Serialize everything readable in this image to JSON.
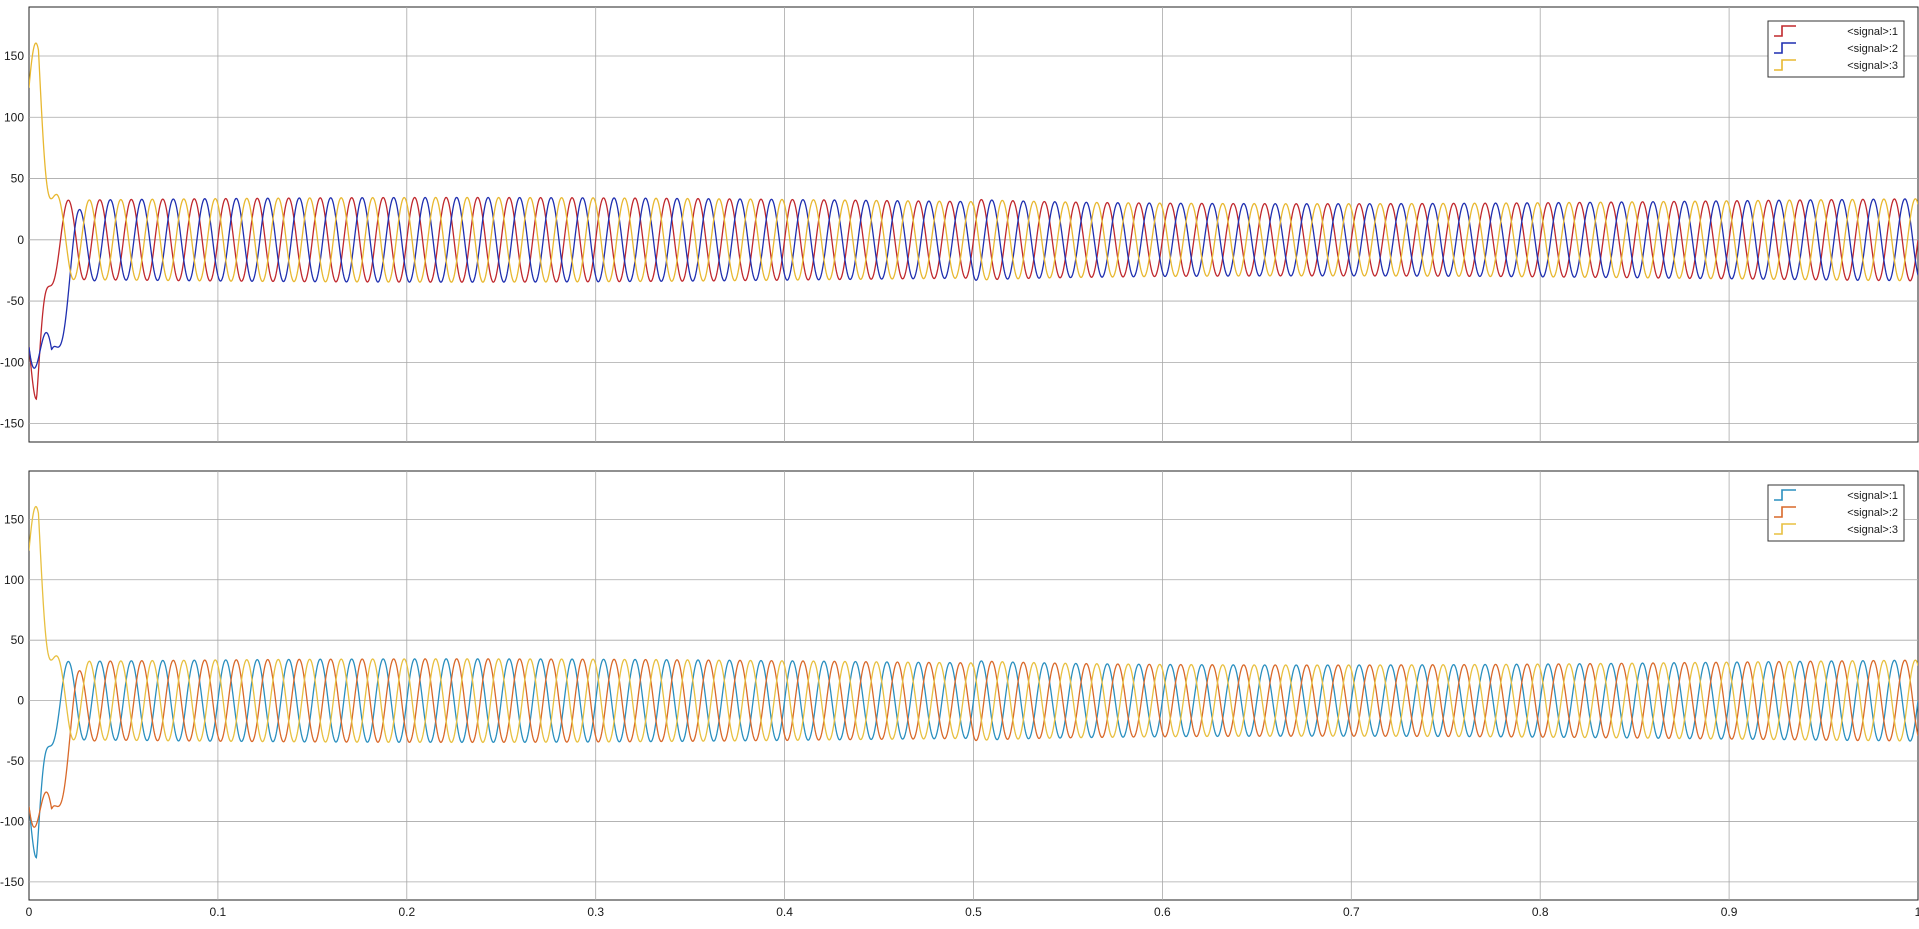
{
  "chart_data": [
    {
      "type": "line",
      "panel": "top",
      "x_range": [
        0,
        1
      ],
      "ylim": [
        -165,
        190
      ],
      "yticks": [
        150,
        100,
        50,
        0,
        -50,
        -100,
        -150
      ],
      "xticks": [
        0.1,
        0.2,
        0.3,
        0.4,
        0.5,
        0.6,
        0.7,
        0.8,
        0.9
      ],
      "x_tick_labels_shown": false,
      "grid": true,
      "legend_position": "top-right",
      "frequency_hz": 60,
      "series": [
        {
          "name": "<signal>:1",
          "color": "#c0282d",
          "steady_amplitude": 32,
          "phase_deg": 0,
          "transient_extreme": {
            "t": 0.004,
            "y": -130
          }
        },
        {
          "name": "<signal>:2",
          "color": "#1f2fb0",
          "steady_amplitude": 32,
          "phase_deg": -120,
          "transient_extreme": {
            "t": 0.012,
            "y": -90
          }
        },
        {
          "name": "<signal>:3",
          "color": "#e8b830",
          "steady_amplitude": 32,
          "phase_deg": 120,
          "transient_extreme": {
            "t": 0.005,
            "y": 155
          }
        }
      ]
    },
    {
      "type": "line",
      "panel": "bottom",
      "x_range": [
        0,
        1
      ],
      "ylim": [
        -165,
        190
      ],
      "yticks": [
        150,
        100,
        50,
        0,
        -50,
        -100,
        -150
      ],
      "xticks": [
        0,
        0.1,
        0.2,
        0.3,
        0.4,
        0.5,
        0.6,
        0.7,
        0.8,
        0.9,
        1
      ],
      "x_tick_labels": [
        "0",
        "0.1",
        "0.2",
        "0.3",
        "0.4",
        "0.5",
        "0.6",
        "0.7",
        "0.8",
        "0.9",
        "1"
      ],
      "grid": true,
      "legend_position": "top-right",
      "frequency_hz": 60,
      "series": [
        {
          "name": "<signal>:1",
          "color": "#2a8fbf",
          "steady_amplitude": 32,
          "phase_deg": 0,
          "transient_extreme": {
            "t": 0.004,
            "y": -130
          }
        },
        {
          "name": "<signal>:2",
          "color": "#d9692a",
          "steady_amplitude": 32,
          "phase_deg": -120,
          "transient_extreme": {
            "t": 0.012,
            "y": -90
          }
        },
        {
          "name": "<signal>:3",
          "color": "#e8c040",
          "steady_amplitude": 32,
          "phase_deg": 120,
          "transient_extreme": {
            "t": 0.005,
            "y": 155
          }
        }
      ]
    }
  ]
}
